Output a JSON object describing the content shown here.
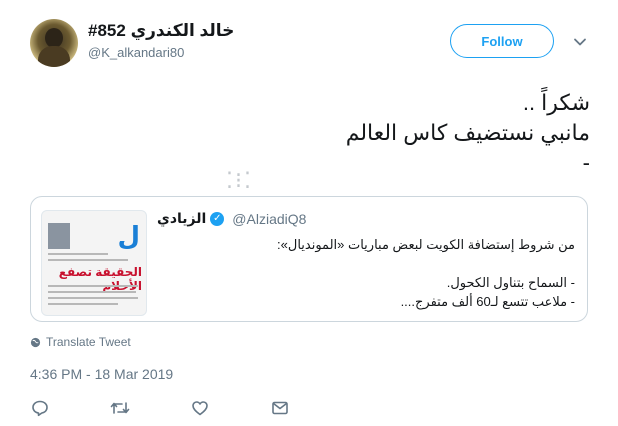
{
  "author": {
    "display_name": "#خالد الكندري 852",
    "handle": "@K_alkandari80"
  },
  "follow_label": "Follow",
  "tweet": {
    "text": "شكراً ..\nمانبي نستضيف كاس العالم\n-"
  },
  "quote": {
    "display_name": "الزيادي",
    "handle": "@AlziadiQ8",
    "text": "من شروط إستضافة الكويت لبعض مباريات «المونديال»:\n\n- السماح بتناول الكحول.\n- ملاعب تتسع لـ60 ألف متفرج....",
    "thumbnail_headline": "الحقيقة تصفع الأحلام"
  },
  "translate_label": "Translate Tweet",
  "timestamp": "4:36 PM - 18 Mar 2019",
  "colors": {
    "accent": "#1da1f2",
    "muted": "#657786",
    "border": "#ccd6dd"
  },
  "icons": [
    "chevron-down-icon",
    "verified-icon",
    "globe-icon",
    "reply-icon",
    "retweet-icon",
    "like-icon",
    "dm-icon"
  ]
}
